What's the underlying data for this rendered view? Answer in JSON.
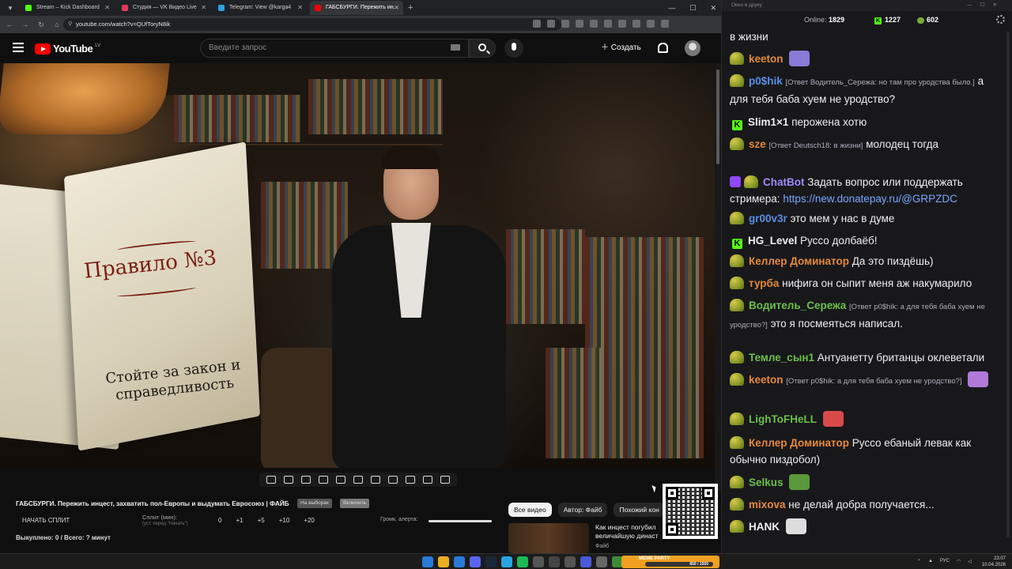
{
  "browser": {
    "tabs": [
      {
        "label": "Stream – Kick Dashboard",
        "color": "#53fc18",
        "active": false
      },
      {
        "label": "Студия — VK Видео Live",
        "color": "#e03a5a",
        "active": false
      },
      {
        "label": "Telegram: View @karga4",
        "color": "#2aa3e0",
        "active": false
      },
      {
        "label": "ГАБСБУРГИ. Пережить ин...",
        "color": "#ff0000",
        "active": true
      }
    ],
    "url": "youtube.com/watch?v=QUfToryN8ik"
  },
  "youtube": {
    "logo_text": "YouTube",
    "region": "LV",
    "search_placeholder": "Введите запрос",
    "create_label": "Создать"
  },
  "video": {
    "rule_title": "Правило №3",
    "rule_text": "Стойте за закон и справедливость"
  },
  "below": {
    "title": "ГАБСБУРГИ. Пережить инцест, захватить пол-Европы и выдумать Евросоюз | ФАЙБ",
    "chip1": "На выборах",
    "chip2": "Включить",
    "split_button": "НАЧАТЬ СПЛИТ",
    "split_label": "Сплит (мин):",
    "split_sub": "(уст. перед \"Начать\")",
    "split_values": [
      "0",
      "+1",
      "+5",
      "+10",
      "+20"
    ],
    "alert_label": "Громк. алерта:",
    "alert_volume": 1.0,
    "bought": "Выкуплено: 0 / Всего: ? минут",
    "rec_chips": [
      "Все видео",
      "Автор: Файб",
      "Похожий кон"
    ],
    "rec_title": "Как инцест погубил величайшую династ",
    "rec_channel": "Файб"
  },
  "chat": {
    "window_title": "Окно в друку",
    "online_label": "Online:",
    "online_count": "1829",
    "kick_count": "1227",
    "twitch_count": "602",
    "messages": [
      {
        "nick": "",
        "color": "#efeff1",
        "text": "в жизни",
        "reply": "",
        "badge": "none"
      },
      {
        "nick": "keeton",
        "color": "#e58a3a",
        "text": "",
        "reply": "",
        "badge": "frog",
        "emote": "#8a7ad8"
      },
      {
        "nick": "p0$hik",
        "color": "#5b8ee6",
        "text": "а для тебя баба хуем не уродство?",
        "reply": "[Ответ Водитель_Сережа: но там про уродства было.]",
        "badge": "frog"
      },
      {
        "nick": "Slim1×1",
        "color": "#efeff1",
        "text": "перожена хотю",
        "reply": "",
        "badge": "kick"
      },
      {
        "nick": "sze",
        "color": "#e58a3a",
        "text": "молодец тогда",
        "reply": "[Ответ Deutsch18: в жизни]",
        "badge": "frog"
      },
      {
        "nick": "ChatBot",
        "color": "#9c8cff",
        "text": "Задать вопрос или поддержать стримера:",
        "link": "https://new.donatepay.ru/@GRPZDC",
        "reply": "",
        "badge": "bot"
      },
      {
        "nick": "gr00v3r",
        "color": "#5b8ee6",
        "text": "это мем у нас в думе",
        "reply": "",
        "badge": "frog"
      },
      {
        "nick": "HG_Level",
        "color": "#efeff1",
        "text": "Руссо долбаёб!",
        "reply": "",
        "badge": "kick"
      },
      {
        "nick": "Келлер Доминатор",
        "color": "#e58a3a",
        "text": "Да это пиздёшь)",
        "reply": "",
        "badge": "frog"
      },
      {
        "nick": "турба",
        "color": "#e58a3a",
        "text": "нифига он сыпит меня аж накумарило",
        "reply": "",
        "badge": "frog"
      },
      {
        "nick": "Водитель_Сережа",
        "color": "#6cc04a",
        "text": "это я посмеяться написал.",
        "reply": "[Ответ p0$hik: а для тебя баба хуем не уродство?]",
        "badge": "frog"
      },
      {
        "nick": "Темле_сын1",
        "color": "#6cc04a",
        "text": "Антуанетту британцы оклеветали",
        "reply": "",
        "badge": "frog"
      },
      {
        "nick": "keeton",
        "color": "#e58a3a",
        "text": "",
        "reply": "[Ответ p0$hik: а для тебя баба хуем не уродство?]",
        "badge": "frog",
        "emote": "#b07ad8"
      },
      {
        "nick": "LighToFHeLL",
        "color": "#6cc04a",
        "text": "",
        "reply": "",
        "badge": "frog",
        "emote": "#d84a4a"
      },
      {
        "nick": "Келлер Доминатор",
        "color": "#e58a3a",
        "text": "Руссо ебаный левак как обычно пиздобол)",
        "reply": "",
        "badge": "frog"
      },
      {
        "nick": "Selkus",
        "color": "#6cc04a",
        "text": "",
        "reply": "",
        "badge": "frog",
        "emote": "#5a9a3a"
      },
      {
        "nick": "mixova",
        "color": "#e58a3a",
        "text": "не делай добра получается...",
        "reply": "",
        "badge": "frog"
      },
      {
        "nick": "HANK",
        "color": "#efeff1",
        "text": "",
        "reply": "",
        "badge": "frog",
        "emote": "#ddd"
      }
    ]
  },
  "taskbar": {
    "meme_label": "MEME PARTY",
    "meme_progress": "850 / 1500",
    "lang": "РУС",
    "time": "23:07",
    "date": "10.04.2026"
  }
}
